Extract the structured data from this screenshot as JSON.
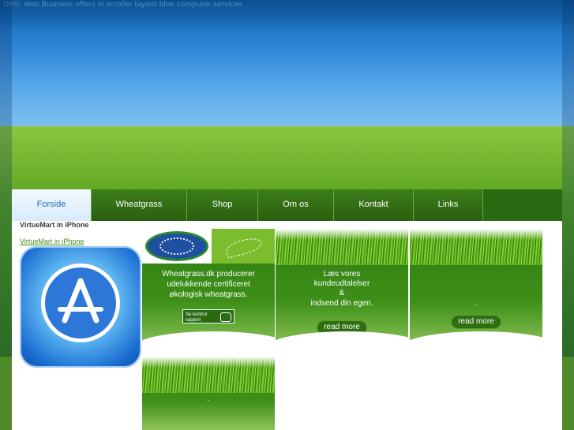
{
  "topbar": {
    "text": "ORG: Web Business offers in scroller layout blue computer services"
  },
  "nav": {
    "items": [
      {
        "label": "Forside",
        "active": true
      },
      {
        "label": "Wheatgrass",
        "active": false
      },
      {
        "label": "Shop",
        "active": false
      },
      {
        "label": "Om os",
        "active": false
      },
      {
        "label": "Kontakt",
        "active": false
      },
      {
        "label": "Links",
        "active": false
      }
    ]
  },
  "sidebar": {
    "title": "VirtueMart in iPhone",
    "link": "VirtueMart in iPhone",
    "icon": "app-store-icon"
  },
  "cards": {
    "card1": {
      "line1": "Wheatgrass.dk producerer",
      "line2": "udelukkende certificeret",
      "line3": "økologisk wheatgrass.",
      "badge_line1": "Se kontrol",
      "badge_line2": "rapport"
    },
    "card2": {
      "line1": "Læs vores",
      "line2": "kundeudtalelser",
      "line3": "&",
      "line4": "indsend din egen.",
      "read_more": "read more"
    },
    "card3": {
      "dot": ".",
      "read_more": "read more"
    },
    "card4": {
      "dot": "."
    }
  },
  "colors": {
    "nav_bg": "#2b5f10",
    "nav_active": "#1f6fb7",
    "accent_green": "#3f8a17",
    "sky_blue": "#2f86d6"
  }
}
